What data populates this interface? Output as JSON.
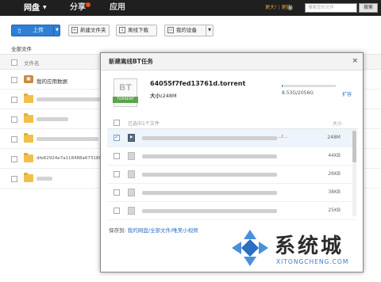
{
  "topbar": {
    "nav_disk": "网盘",
    "nav_share": "分享",
    "nav_apps": "应用",
    "links": [
      "更大!",
      "更快!"
    ],
    "search_placeholder": "搜索您的文件",
    "search_button": "搜索"
  },
  "toolbar": {
    "upload_label": "上传",
    "new_folder_label": "新建文件夹",
    "offline_download_label": "离线下载",
    "my_devices_label": "我的设备"
  },
  "breadcrumb": "全部文件",
  "list": {
    "column_filename": "文件名",
    "rows": [
      {
        "name": "我的应用数据",
        "type": "app"
      },
      {
        "name": "",
        "type": "folder"
      },
      {
        "name": "",
        "type": "folder"
      },
      {
        "name": "",
        "type": "folder"
      },
      {
        "name": "dfe62924e7a118488a673188",
        "type": "folder"
      },
      {
        "name": "",
        "type": "folder"
      }
    ]
  },
  "dialog": {
    "title": "新建离线BT任务",
    "close_glyph": "×",
    "bt_icon_text": "BT",
    "bt_icon_badge": "TORRENT",
    "torrent_name": "64055f7fed13761d.torrent",
    "size_key": "大小:",
    "size_value": "248M",
    "quota_text": "8.53G/2056G",
    "quota_fraction": 0.004,
    "expand_link": "扩容",
    "selected_text": "已选中1个文件",
    "size_column": "大小",
    "files": [
      {
        "checked": true,
        "kind": "video",
        "size": "248M"
      },
      {
        "checked": false,
        "kind": "file",
        "size": "44KB"
      },
      {
        "checked": false,
        "kind": "file",
        "size": "26KB"
      },
      {
        "checked": false,
        "kind": "file",
        "size": "38KB"
      },
      {
        "checked": false,
        "kind": "file",
        "size": "25KB"
      }
    ],
    "save_label": "保存到:",
    "save_path": "我的网盘/全部文件/唯美小视频"
  },
  "watermark": {
    "title": "系统城",
    "url": "XITONGCHENG.COM"
  },
  "colors": {
    "topbar_bg": "#1f1f1f",
    "accent_blue": "#2f7fd6",
    "link_orange": "#f0a030"
  }
}
